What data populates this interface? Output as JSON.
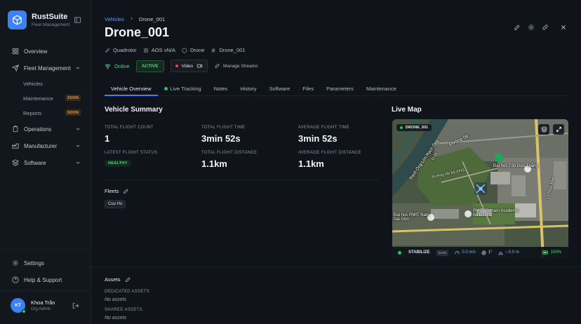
{
  "app": {
    "name": "RustSuite",
    "subtitle": "Fleet Management"
  },
  "sidebar": {
    "overview": "Overview",
    "fleet_management": "Fleet Management",
    "sub": {
      "vehicles": "Vehicles",
      "maintenance": "Maintenance",
      "reports": "Reports",
      "soon": "SOON"
    },
    "operations": "Operations",
    "manufacturer": "Manufacturer",
    "software": "Software",
    "settings": "Settings",
    "help": "Help & Support"
  },
  "user": {
    "initials": "KT",
    "name": "Khoa Trần",
    "role": "Org Admin"
  },
  "breadcrumb": {
    "parent": "Vehicles",
    "current": "Drone_001"
  },
  "vehicle": {
    "title": "Drone_001",
    "meta": {
      "type": "Quadrotor",
      "os": "AOS vN/A",
      "category": "Drone",
      "id": "Drone_001"
    },
    "online": "Online",
    "status": "ACTIVE",
    "video": "Video",
    "manage_streams": "Manage Streams"
  },
  "tabs": [
    "Vehicle Overview",
    "Live Tracking",
    "Notes",
    "History",
    "Software",
    "Files",
    "Parameters",
    "Maintenance"
  ],
  "summary": {
    "title": "Vehicle Summary",
    "total_flight_count_label": "TOTAL FLIGHT COUNT",
    "total_flight_count": "1",
    "total_flight_time_label": "TOTAL FLIGHT TIME",
    "total_flight_time": "3min 52s",
    "average_flight_time_label": "AVERAGE FLIGHT TIME",
    "average_flight_time": "3min 52s",
    "latest_status_label": "LATEST FLIGHT STATUS",
    "latest_status": "HEALTHY",
    "total_distance_label": "TOTAL FLIGHT DISTANCE",
    "total_distance": "1.1km",
    "average_distance_label": "AVERAGE FLIGHT DISTANCE",
    "average_distance": "1.1km"
  },
  "fleets": {
    "label": "Fleets",
    "items": [
      "Cuu Ho"
    ]
  },
  "assets": {
    "label": "Assets",
    "dedicated_label": "DEDICATED ASSETS",
    "dedicated_value": "No assets",
    "shared_label": "SHARED ASSETS",
    "shared_value": "No assets"
  },
  "live_map": {
    "title": "Live Map",
    "drone_tag": "DRONE_001",
    "labels": {
      "duong06": "Đường 06",
      "rach": "Rạch Ông Lớn Rạch Ông",
      "d01": "D.01",
      "dh_ton": "Đại học Tôn Đức Thắng",
      "noi_bo": "Đường nội bộ VFIS",
      "ly_phuc": "Lý Phục Man",
      "rmit": "RMIT Vietnam Academic Building 2",
      "dhrmit": "Đại học RMIT Nam Sài Gòn"
    },
    "telemetry": {
      "mode": "STABILIZE",
      "safe": "SAFE",
      "speed": "0.0 m/s",
      "heading": "1°",
      "alt": "↑-0.0 m",
      "battery": "100%"
    }
  },
  "colors": {
    "accent": "#3b82f6",
    "success": "#22c55e",
    "warning": "#e4a05a"
  }
}
